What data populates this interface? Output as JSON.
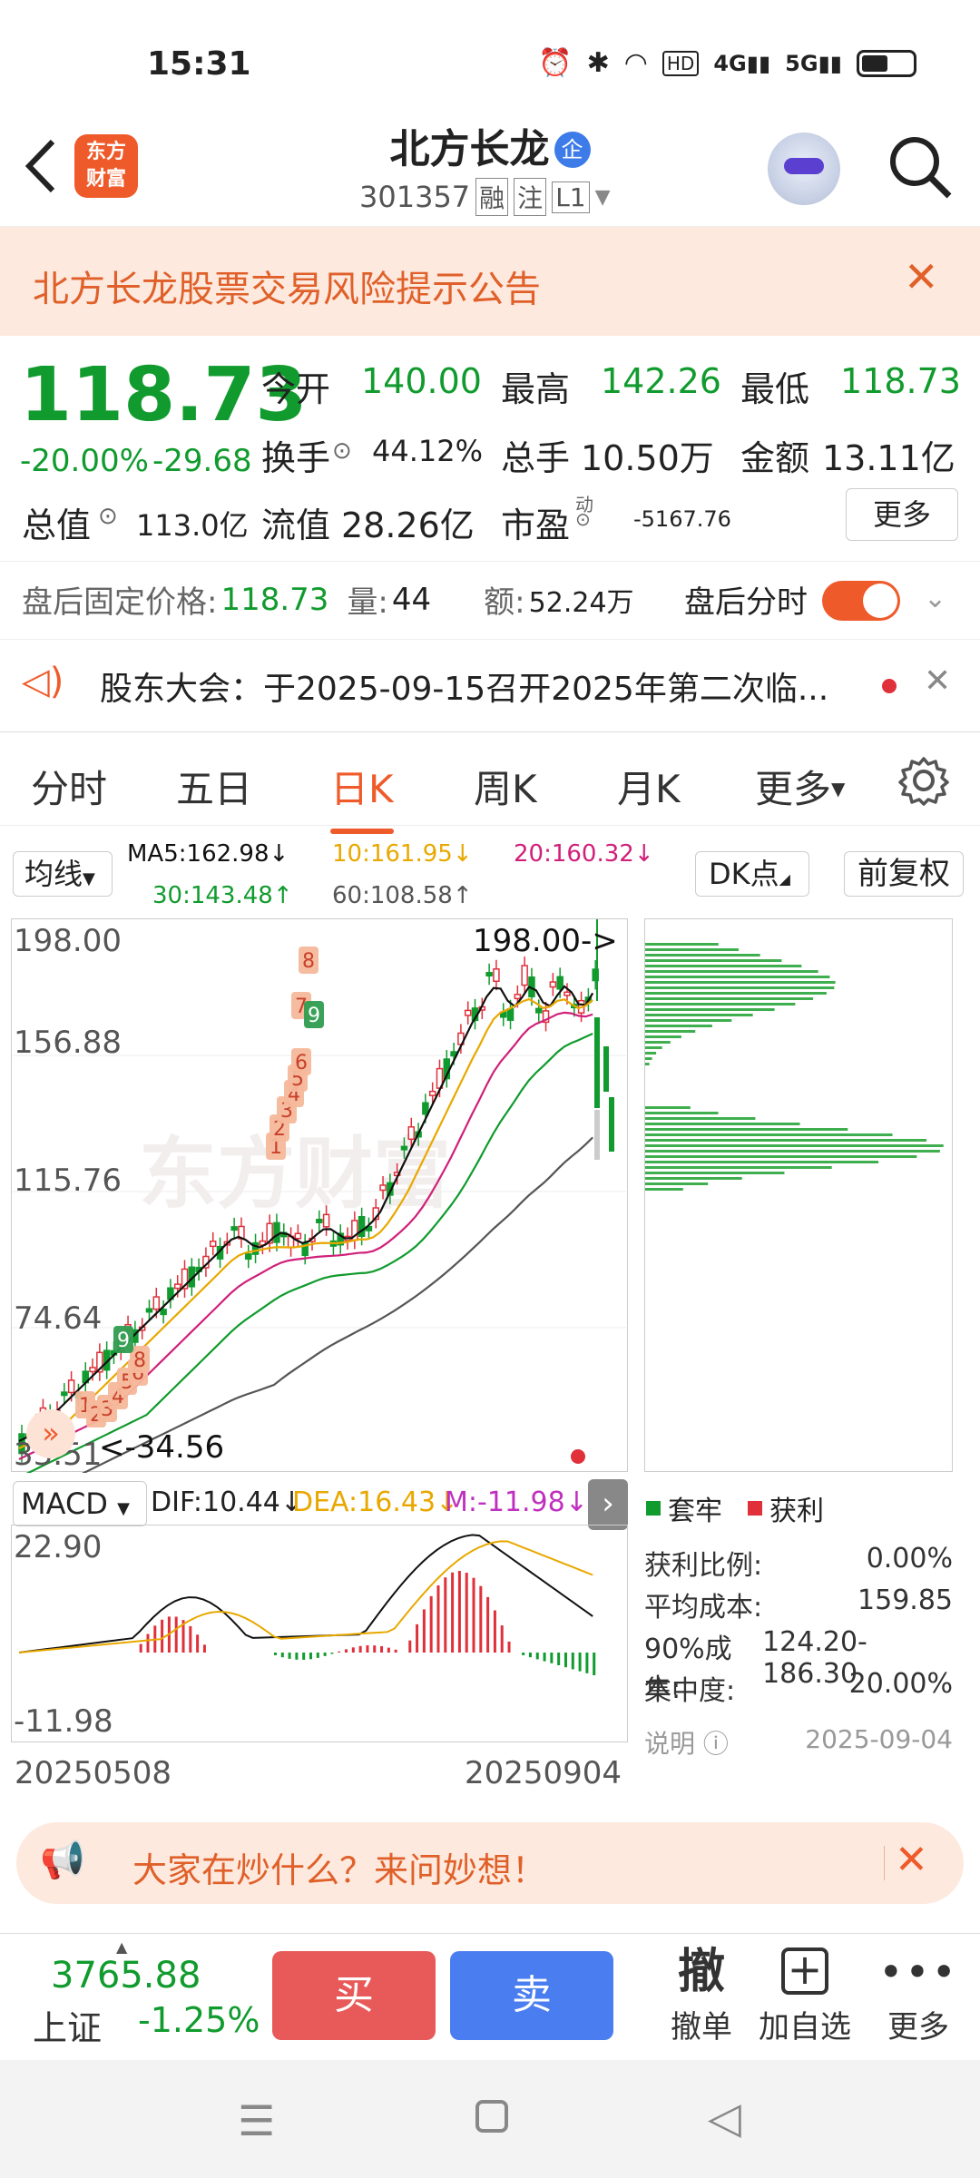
{
  "status": {
    "time": "15:31",
    "net_a": "4G",
    "net_b": "5G"
  },
  "header": {
    "logo_text_1": "东方",
    "logo_text_2": "财富",
    "title": "北方长龙",
    "title_badge": "企",
    "code": "301357",
    "tag1": "融",
    "tag2": "注",
    "tag3": "L1"
  },
  "risk": {
    "text": "北方长龙股票交易风险提示公告"
  },
  "quote": {
    "price": "118.73",
    "pct": "-20.00%",
    "chg": "-29.68",
    "open_label": "今开",
    "open": "140.00",
    "high_label": "最高",
    "high": "142.26",
    "low_label": "最低",
    "low": "118.73",
    "turnover_label": "换手",
    "turnover": "44.12%",
    "vol_label": "总手",
    "vol": "10.50万",
    "amt_label": "金额",
    "amt": "13.11亿",
    "mcap_label": "总值",
    "mcap": "113.0亿",
    "float_label": "流值",
    "float": "28.26亿",
    "pe_label": "市盈",
    "pe_sup": "动",
    "pe": "-5167.76",
    "more": "更多"
  },
  "afterhours": {
    "price_label": "盘后固定价格:",
    "price": "118.73",
    "vol_label": "量:",
    "vol": "44",
    "amt_label": "额:",
    "amt": "52.24万",
    "toggle_label": "盘后分时",
    "toggle_on": true
  },
  "notice": {
    "text": "股东大会：于2025-09-15召开2025年第二次临..."
  },
  "tabs": [
    "分时",
    "五日",
    "日K",
    "周K",
    "月K",
    "更多"
  ],
  "active_tab": "日K",
  "ma": {
    "selector": "均线",
    "ma5": "MA5:162.98↓",
    "ma10": "10:161.95↓",
    "ma20": "20:160.32↓",
    "ma30": "30:143.48↑",
    "ma60": "60:108.58↑",
    "dk": "DK点",
    "adj": "前复权"
  },
  "colors": {
    "ma5": "#111111",
    "ma10": "#e8a800",
    "ma20": "#d0207a",
    "ma30": "#119b2e",
    "ma60": "#555555",
    "up": "#e0303a",
    "down": "#119b2e",
    "accent": "#ef5a2a"
  },
  "kchart": {
    "y_labels": [
      "198.00",
      "156.88",
      "115.76",
      "74.64",
      "33.51"
    ],
    "high_label": "198.00->",
    "low_label": "<-34.56",
    "watermark": "东方财富",
    "signals": [
      "1",
      "2",
      "3",
      "4",
      "5",
      "6",
      "8",
      "9",
      "1",
      "2",
      "3",
      "4",
      "5",
      "6",
      "7",
      "8",
      "9"
    ]
  },
  "macd": {
    "selector": "MACD",
    "dif": "DIF:10.44↓",
    "dea": "DEA:16.43↓",
    "m": "M:-11.98↓",
    "y_top": "22.90",
    "y_bottom": "-11.98",
    "date_start": "20250508",
    "date_end": "20250904"
  },
  "chip": {
    "legend_trapped": "套牢",
    "legend_profit": "获利",
    "profit_ratio_label": "获利比例:",
    "profit_ratio": "0.00%",
    "avg_cost_label": "平均成本:",
    "avg_cost": "159.85",
    "cost90_label": "90%成本:",
    "cost90": "124.20-186.30",
    "concentration_label": "集中度:",
    "concentration": "20.00%",
    "note_label": "说明",
    "date": "2025-09-04"
  },
  "ask": {
    "text": "大家在炒什么？来问妙想！"
  },
  "bottom": {
    "index_value": "3765.88",
    "index_name": "上证",
    "index_pct": "-1.25%",
    "buy": "买",
    "sell": "卖",
    "cancel_icon": "撤",
    "cancel": "撤单",
    "add": "加自选",
    "more": "更多"
  }
}
